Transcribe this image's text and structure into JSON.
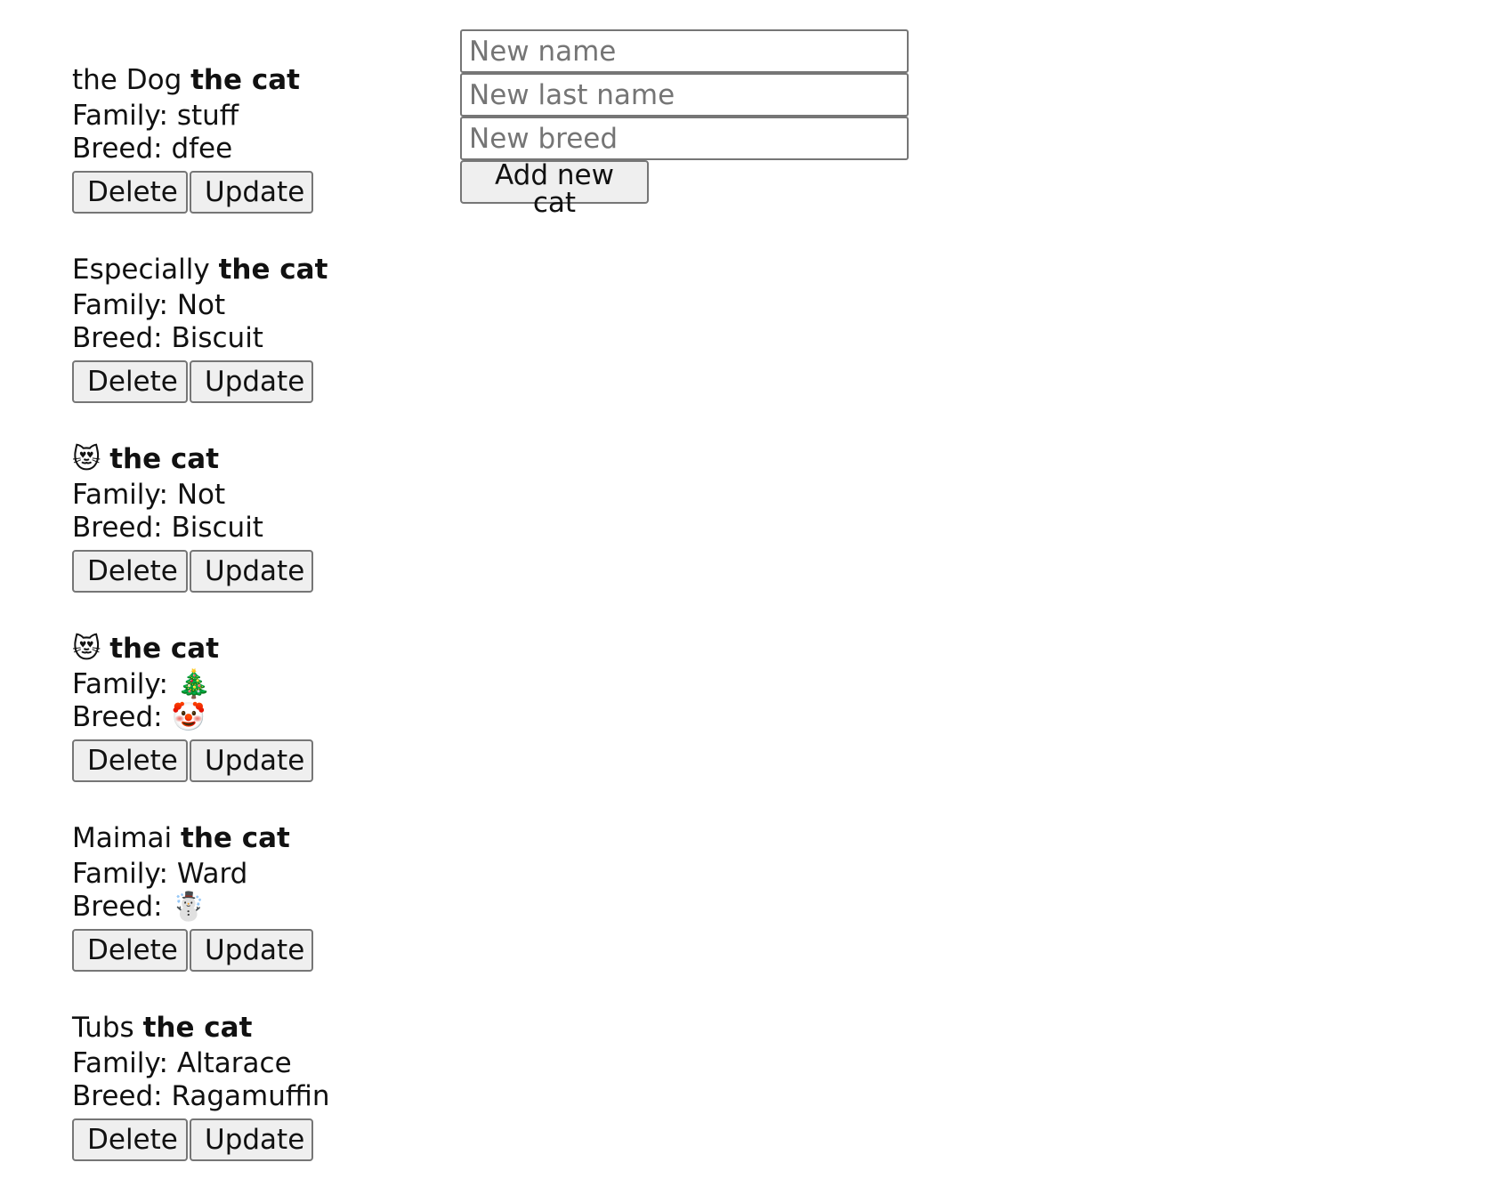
{
  "cats": [
    {
      "name": "the Dog",
      "suffix": "the cat",
      "family_label": "Family:",
      "family": "stuff",
      "breed_label": "Breed:",
      "breed": "dfee"
    },
    {
      "name": "Especially",
      "suffix": "the cat",
      "family_label": "Family:",
      "family": "Not",
      "breed_label": "Breed:",
      "breed": "Biscuit"
    },
    {
      "name": "😻",
      "suffix": "the cat",
      "family_label": "Family:",
      "family": "Not",
      "breed_label": "Breed:",
      "breed": "Biscuit"
    },
    {
      "name": "😻",
      "suffix": "the cat",
      "family_label": "Family:",
      "family": "🎄",
      "breed_label": "Breed:",
      "breed": "🤡"
    },
    {
      "name": "Maimai",
      "suffix": "the cat",
      "family_label": "Family:",
      "family": "Ward",
      "breed_label": "Breed:",
      "breed": "☃️"
    },
    {
      "name": "Tubs",
      "suffix": "the cat",
      "family_label": "Family:",
      "family": "Altarace",
      "breed_label": "Breed:",
      "breed": "Ragamuffin"
    }
  ],
  "buttons": {
    "delete_label": "Delete",
    "update_label": "Update"
  },
  "form": {
    "name_placeholder": "New name",
    "last_name_placeholder": "New last name",
    "breed_placeholder": "New breed",
    "add_button_label": "Add new cat"
  }
}
